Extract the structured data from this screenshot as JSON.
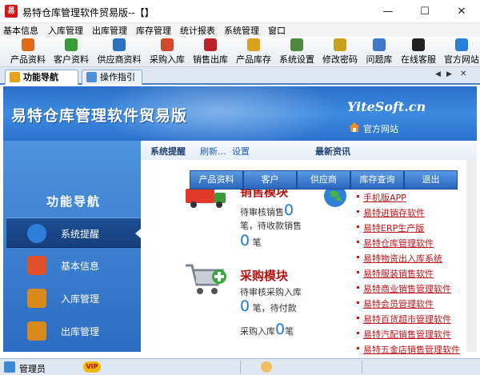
{
  "window": {
    "logo_text": "易",
    "title": "易特仓库管理软件贸易版--【】",
    "min_glyph": "—",
    "max_glyph": "☐",
    "close_glyph": "✕"
  },
  "menu": [
    "基本信息",
    "入库管理",
    "出库管理",
    "库存管理",
    "统计报表",
    "系统管理",
    "窗口"
  ],
  "toolbar": [
    {
      "label": "产品资料",
      "icon": "product-icon",
      "color": "#e06a1b"
    },
    {
      "label": "客户资料",
      "icon": "customer-icon",
      "color": "#3a9a3a"
    },
    {
      "label": "供应商资料",
      "icon": "supplier-icon",
      "color": "#2f6fc0"
    },
    {
      "label": "采购入库",
      "icon": "purchase-icon",
      "color": "#d14a2a"
    },
    {
      "label": "销售出库",
      "icon": "sales-icon",
      "color": "#c0222a"
    },
    {
      "label": "产品库存",
      "icon": "stock-icon",
      "color": "#d9a21a"
    },
    {
      "label": "系统设置",
      "icon": "settings-icon",
      "color": "#4a8a3a"
    },
    {
      "label": "修改密码",
      "icon": "password-icon",
      "color": "#c8a020"
    },
    {
      "label": "问题库",
      "icon": "faq-icon",
      "color": "#3a7ac8"
    },
    {
      "label": "在线客服",
      "icon": "qq-icon",
      "color": "#222222"
    },
    {
      "label": "官方网站",
      "icon": "ie-icon",
      "color": "#2a7fd8"
    }
  ],
  "tabs": [
    {
      "label": "功能导航"
    },
    {
      "label": "操作指引"
    }
  ],
  "tab_nav": {
    "prev": "◀",
    "next": "▶",
    "close": "✕"
  },
  "banner": {
    "title": "易特仓库管理软件贸易版",
    "brand": "YiteSoft.cn",
    "home_link": "官方网站"
  },
  "nav": {
    "header": "功能导航",
    "items": [
      {
        "label": "系统提醒",
        "icon": "info-icon",
        "color": "#2e7fd9"
      },
      {
        "label": "基本信息",
        "icon": "cubes-icon",
        "color": "#e0502a"
      },
      {
        "label": "入库管理",
        "icon": "box-in-icon",
        "color": "#d88a1a"
      },
      {
        "label": "出库管理",
        "icon": "box-out-icon",
        "color": "#d88a1a"
      }
    ]
  },
  "main": {
    "sys_remind": "系统提醒",
    "refresh": "刷新...",
    "settings": "设置",
    "news_title": "最新资讯",
    "buttons": [
      "产品资料",
      "客户",
      "供应商",
      "库存查询",
      "退出"
    ],
    "sales": {
      "title": "销售模块",
      "pending_audit_label": "待审核销售",
      "pending_audit_value": "0",
      "pending_receipt_label": "笔，待收款销售",
      "pending_receipt_value": "0",
      "unit": "笔"
    },
    "purchase": {
      "title": "采购模块",
      "pending_audit_label": "待审核采购入库",
      "pending_audit_value": "0",
      "pending_pay_label": "笔，待付款",
      "inbound_label": "采购入库",
      "inbound_value": "0",
      "unit": "笔"
    },
    "news": [
      "手机版APP",
      "易特进销存软件",
      "易特ERP生产版",
      "易特仓库管理软件",
      "易特物资出入库系统",
      "易特服装销售软件",
      "易特商业销售管理软件",
      "易特会员管理软件",
      "易特百货超市管理软件",
      "易特汽配销售管理软件",
      "易特五金店销售管理软件"
    ]
  },
  "status": {
    "user": "管理员",
    "vip": "VIP"
  }
}
